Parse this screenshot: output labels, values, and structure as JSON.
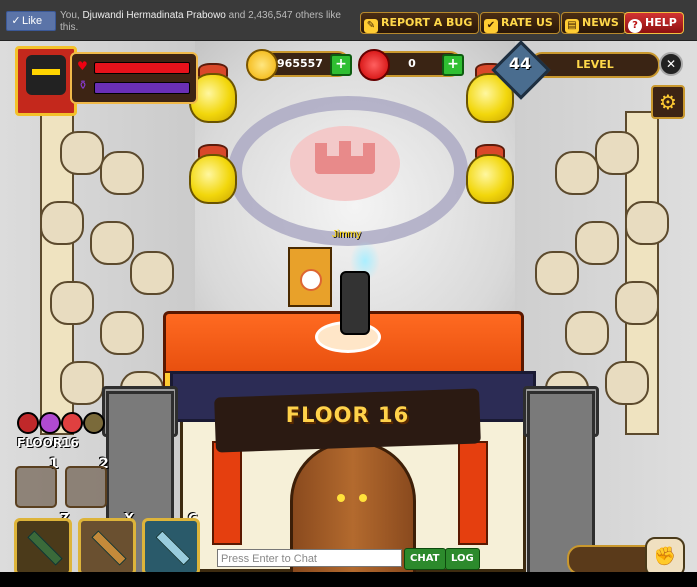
{
  "facebook": {
    "like_label": "Like",
    "like_prefix": "You,",
    "like_name": "Djuwandi Hermadinata Prabowo",
    "like_suffix": "and 2,436,547 others like this."
  },
  "top_buttons": {
    "report_bug": "REPORT A BUG",
    "rate_us": "RATE US",
    "news": "NEWS",
    "help": "HELP"
  },
  "hud": {
    "gold": "965557",
    "gems": "0",
    "level_number": "44",
    "level_label": "LEVEL",
    "hp_fraction": 1.0,
    "mp_fraction": 1.0
  },
  "player": {
    "name": "Jimmy"
  },
  "floor": {
    "banner_text": "FLOOR 16",
    "side_label": "FLOOR16"
  },
  "skill_slots": [
    "1",
    "2"
  ],
  "weapon_keys": [
    "Z",
    "X",
    "C"
  ],
  "chat": {
    "placeholder": "Press Enter to Chat",
    "chat_button": "CHAT",
    "log_button": "LOG"
  },
  "icons": {
    "close": "close-icon",
    "settings": "gear-icon",
    "gold": "gold-coin-icon",
    "gem": "gem-icon"
  },
  "colors": {
    "hp": "#e6121b",
    "mp": "#6a2fb5",
    "gold_text": "#ffd84a",
    "help_button": "#d23333"
  }
}
